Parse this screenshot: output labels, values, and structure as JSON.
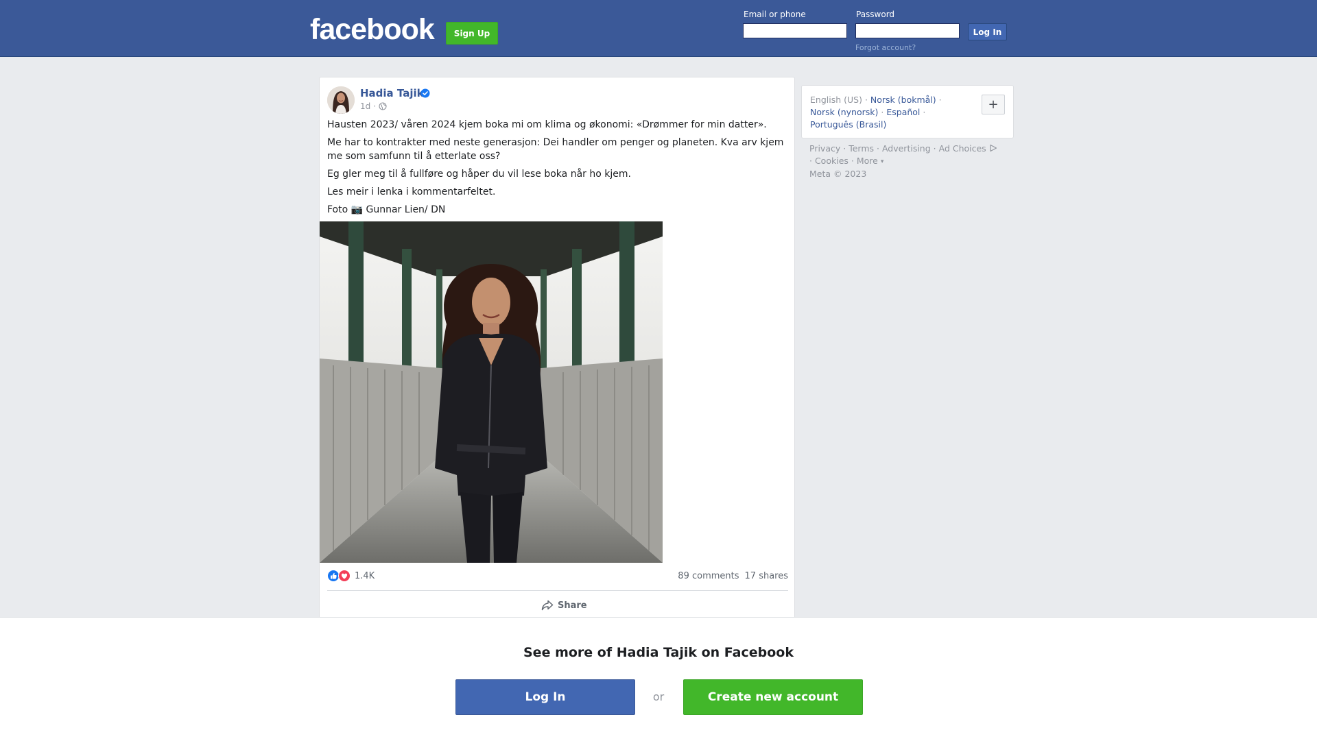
{
  "header": {
    "logo_text": "facebook",
    "signup_label": "Sign Up",
    "email_label": "Email or phone",
    "email_value": "",
    "password_label": "Password",
    "password_value": "",
    "login_label": "Log In",
    "forgot_label": "Forgot account?",
    "bar_color": "#3b5998"
  },
  "post": {
    "author": "Hadia Tajik",
    "verified": true,
    "time": "1d",
    "time_separator": "·",
    "audience_icon": "globe-icon",
    "paragraphs": [
      "Hausten 2023/ våren 2024 kjem boka mi om klima og økonomi: «Drømmer for min datter».",
      "Me har to kontrakter med neste generasjon: Dei handler om penger og planeten. Kva arv kjem me som samfunn til å etterlate oss?",
      "Eg gler meg til å fullføre og håper du vil lese boka når ho kjem.",
      "Les meir i lenka i kommentarfeltet.",
      "Foto 📷 Gunnar Lien/ DN"
    ],
    "reactions": {
      "icons": [
        "like-icon",
        "love-icon"
      ],
      "count": "1.4K"
    },
    "comments": "89 comments",
    "shares": "17 shares",
    "share_label": "Share"
  },
  "languages": {
    "current": "English (US)",
    "options": [
      "Norsk (bokmål)",
      "Norsk (nynorsk)",
      "Español",
      "Português (Brasil)"
    ],
    "add_label": "+"
  },
  "footer": {
    "links": [
      "Privacy",
      "Terms",
      "Advertising",
      "Ad Choices",
      "Cookies",
      "More"
    ],
    "separator": "·",
    "copyright": "Meta © 2023"
  },
  "banner": {
    "title": "See more of Hadia Tajik on Facebook",
    "login_label": "Log In",
    "or_label": "or",
    "create_label": "Create new account"
  },
  "colors": {
    "brand_blue": "#4267b2",
    "brand_green": "#42b72a",
    "link_blue": "#385898",
    "page_bg": "#e9ebee"
  }
}
